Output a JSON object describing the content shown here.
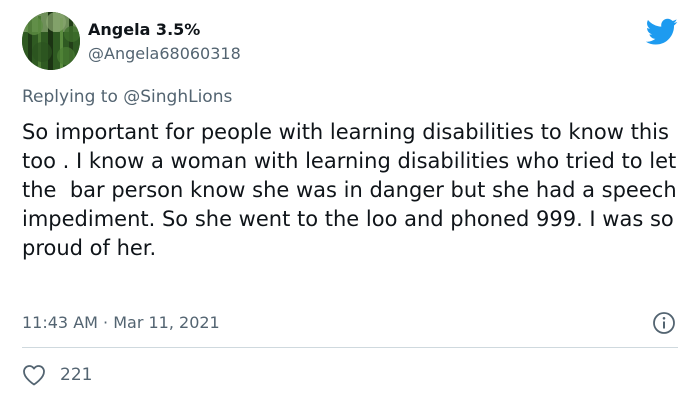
{
  "author": {
    "display_name": "Angela 3.5%",
    "handle": "@Angela68060318"
  },
  "reply": {
    "prefix": "Replying to ",
    "to": "@SinghLions"
  },
  "tweet": {
    "text": "So important for people with learning disabilities to know this too . I know a woman with learning disabilities who tried to let the  bar person know she was in danger but she had a speech impediment. So she went to the loo and phoned 999. I was so proud of her.",
    "timestamp": "11:43 AM · Mar 11, 2021"
  },
  "engagement": {
    "likes": "221"
  },
  "icons": {
    "brand": "twitter-bird-icon",
    "info": "info-icon",
    "like": "heart-icon"
  },
  "colors": {
    "brand_blue": "#1d9bf0",
    "secondary_text": "#536471",
    "primary_text": "#0f1419",
    "divider": "#cfd9de"
  }
}
